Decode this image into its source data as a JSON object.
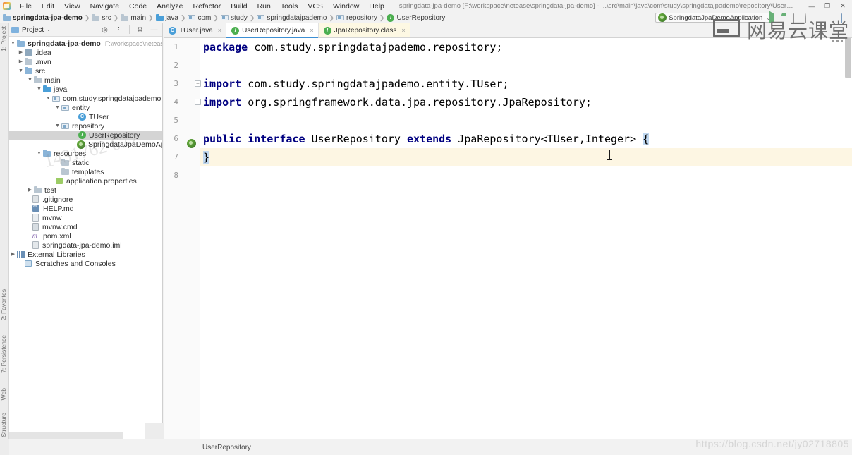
{
  "titlebar": {
    "window_title": "springdata-jpa-demo [F:\\workspace\\netease\\springdata-jpa-demo] - ...\\src\\main\\java\\com\\study\\springdatajpademo\\repository\\UserRepository.java - IntelliJ IDEA",
    "menus": [
      "File",
      "Edit",
      "View",
      "Navigate",
      "Code",
      "Analyze",
      "Refactor",
      "Build",
      "Run",
      "Tools",
      "VCS",
      "Window",
      "Help"
    ],
    "window_buttons": {
      "minimize": "—",
      "maximize": "❐",
      "close": "✕"
    }
  },
  "breadcrumb": {
    "items": [
      {
        "label": "springdata-jpa-demo",
        "icon": "module-icon"
      },
      {
        "label": "src",
        "icon": "folder-src-icon"
      },
      {
        "label": "main",
        "icon": "folder-icon"
      },
      {
        "label": "java",
        "icon": "folder-java-icon"
      },
      {
        "label": "com",
        "icon": "package-icon"
      },
      {
        "label": "study",
        "icon": "package-icon"
      },
      {
        "label": "springdatajpademo",
        "icon": "package-icon"
      },
      {
        "label": "repository",
        "icon": "package-icon"
      },
      {
        "label": "UserRepository",
        "icon": "interface-icon"
      }
    ],
    "separator": "❯"
  },
  "toolbar": {
    "run_config": "SpringdataJpaDemoApplication",
    "run_config_chevron": "⌄",
    "icons": [
      "run-icon",
      "debug-icon",
      "run-with-coverage-icon",
      "profile-icon",
      "stop-icon",
      "build-icon",
      "search-everywhere-icon"
    ]
  },
  "left_tool_strip": {
    "tabs": [
      "1: Project",
      "2: Favorites",
      "7: Persistence",
      "Web",
      "1: Structure"
    ]
  },
  "project_panel": {
    "title": "Project",
    "title_chevron": "⌄",
    "tools": [
      "collapse-all-icon",
      "expand-collapse-icon",
      "settings-gear-icon",
      "hide-icon"
    ],
    "watermark": "1431762 672",
    "tree": [
      {
        "label": "springdata-jpa-demo",
        "path": "F:\\workspace\\netease\\spring",
        "indent": 0,
        "arrow": "expanded",
        "icon": "module-icon",
        "bold": true
      },
      {
        "label": ".idea",
        "indent": 1,
        "arrow": "collapsed",
        "icon": "folder-idea-icon"
      },
      {
        "label": ".mvn",
        "indent": 1,
        "arrow": "collapsed",
        "icon": "folder-icon"
      },
      {
        "label": "src",
        "indent": 1,
        "arrow": "expanded",
        "icon": "folder-src-icon"
      },
      {
        "label": "main",
        "indent": 2,
        "arrow": "expanded",
        "icon": "folder-icon"
      },
      {
        "label": "java",
        "indent": 3,
        "arrow": "expanded",
        "icon": "folder-java-icon"
      },
      {
        "label": "com.study.springdatajpademo",
        "indent": 4,
        "arrow": "expanded",
        "icon": "package-icon"
      },
      {
        "label": "entity",
        "indent": 5,
        "arrow": "expanded",
        "icon": "package-icon"
      },
      {
        "label": "TUser",
        "indent": 6,
        "arrow": "none",
        "icon": "class-icon"
      },
      {
        "label": "repository",
        "indent": 5,
        "arrow": "expanded",
        "icon": "package-icon"
      },
      {
        "label": "UserRepository",
        "indent": 6,
        "arrow": "none",
        "icon": "interface-icon",
        "selected": true
      },
      {
        "label": "SpringdataJpaDemoApplication",
        "indent": 6,
        "arrow": "none",
        "icon": "spring-class-icon"
      },
      {
        "label": "resources",
        "indent": 3,
        "arrow": "expanded",
        "icon": "folder-resources-icon"
      },
      {
        "label": "static",
        "indent": 4,
        "arrow": "none",
        "icon": "folder-icon"
      },
      {
        "label": "templates",
        "indent": 4,
        "arrow": "none",
        "icon": "folder-icon"
      },
      {
        "label": "application.properties",
        "indent": 4,
        "arrow": "none",
        "icon": "properties-file-icon"
      },
      {
        "label": "test",
        "indent": 2,
        "arrow": "collapsed",
        "icon": "folder-icon"
      },
      {
        "label": ".gitignore",
        "indent": 1,
        "arrow": "none",
        "icon": "gitignore-file-icon"
      },
      {
        "label": "HELP.md",
        "indent": 1,
        "arrow": "none",
        "icon": "markdown-file-icon"
      },
      {
        "label": "mvnw",
        "indent": 1,
        "arrow": "none",
        "icon": "file-icon"
      },
      {
        "label": "mvnw.cmd",
        "indent": 1,
        "arrow": "none",
        "icon": "shell-file-icon"
      },
      {
        "label": "pom.xml",
        "indent": 1,
        "arrow": "none",
        "icon": "maven-xml-icon"
      },
      {
        "label": "springdata-jpa-demo.iml",
        "indent": 1,
        "arrow": "none",
        "icon": "iml-file-icon"
      },
      {
        "label": "External Libraries",
        "indent": 0,
        "arrow": "collapsed",
        "icon": "libraries-icon"
      },
      {
        "label": "Scratches and Consoles",
        "indent": 0,
        "arrow": "none",
        "icon": "scratches-icon"
      }
    ]
  },
  "editor": {
    "tabs": [
      {
        "label": "TUser.java",
        "icon": "class-icon",
        "active": false,
        "close": "×"
      },
      {
        "label": "UserRepository.java",
        "icon": "interface-icon",
        "active": true,
        "close": "×"
      },
      {
        "label": "JpaRepository.class",
        "icon": "interface-decompiled-icon",
        "active": false,
        "close": "×"
      }
    ],
    "line_numbers": [
      "1",
      "2",
      "3",
      "4",
      "5",
      "6",
      "7",
      "8"
    ],
    "lines": [
      {
        "n": 1,
        "tokens": [
          {
            "t": "package ",
            "c": "kw"
          },
          {
            "t": "com.study.springdatajpademo.repository;",
            "c": "pl"
          }
        ]
      },
      {
        "n": 2,
        "tokens": []
      },
      {
        "n": 3,
        "tokens": [
          {
            "t": "import ",
            "c": "kw"
          },
          {
            "t": "com.study.springdatajpademo.entity.TUser;",
            "c": "pl"
          }
        ],
        "fold": true
      },
      {
        "n": 4,
        "tokens": [
          {
            "t": "import ",
            "c": "kw"
          },
          {
            "t": "org.springframework.data.jpa.repository.JpaRepository;",
            "c": "pl"
          }
        ],
        "fold": true
      },
      {
        "n": 5,
        "tokens": []
      },
      {
        "n": 6,
        "tokens": [
          {
            "t": "public ",
            "c": "kw"
          },
          {
            "t": "interface ",
            "c": "kw"
          },
          {
            "t": "UserRepository ",
            "c": "pl"
          },
          {
            "t": "extends ",
            "c": "kw"
          },
          {
            "t": "JpaRepository<TUser,Integer> ",
            "c": "pl"
          },
          {
            "t": "{",
            "c": "brace"
          }
        ],
        "gutter_icon": "spring-bean-icon"
      },
      {
        "n": 7,
        "tokens": [
          {
            "t": "}",
            "c": "brace"
          }
        ],
        "highlight": true,
        "caret": true
      },
      {
        "n": 8,
        "tokens": []
      }
    ],
    "full_text": "package com.study.springdatajpademo.repository;\n\nimport com.study.springdatajpademo.entity.TUser;\nimport org.springframework.data.jpa.repository.JpaRepository;\n\npublic interface UserRepository extends JpaRepository<TUser,Integer> {\n}\n"
  },
  "statusbar": {
    "status_text": "UserRepository"
  },
  "watermarks": {
    "netease_cn": "网易云课堂",
    "csdn_url": "https://blog.csdn.net/jy02718805"
  },
  "colors": {
    "accent": "#3c8fd4",
    "keyword": "#000080",
    "selection": "#d4d4d4",
    "caret_line": "#fdf6e3",
    "interface_green": "#4caf50",
    "class_blue": "#4a9fd8",
    "run_green": "#59a869"
  }
}
